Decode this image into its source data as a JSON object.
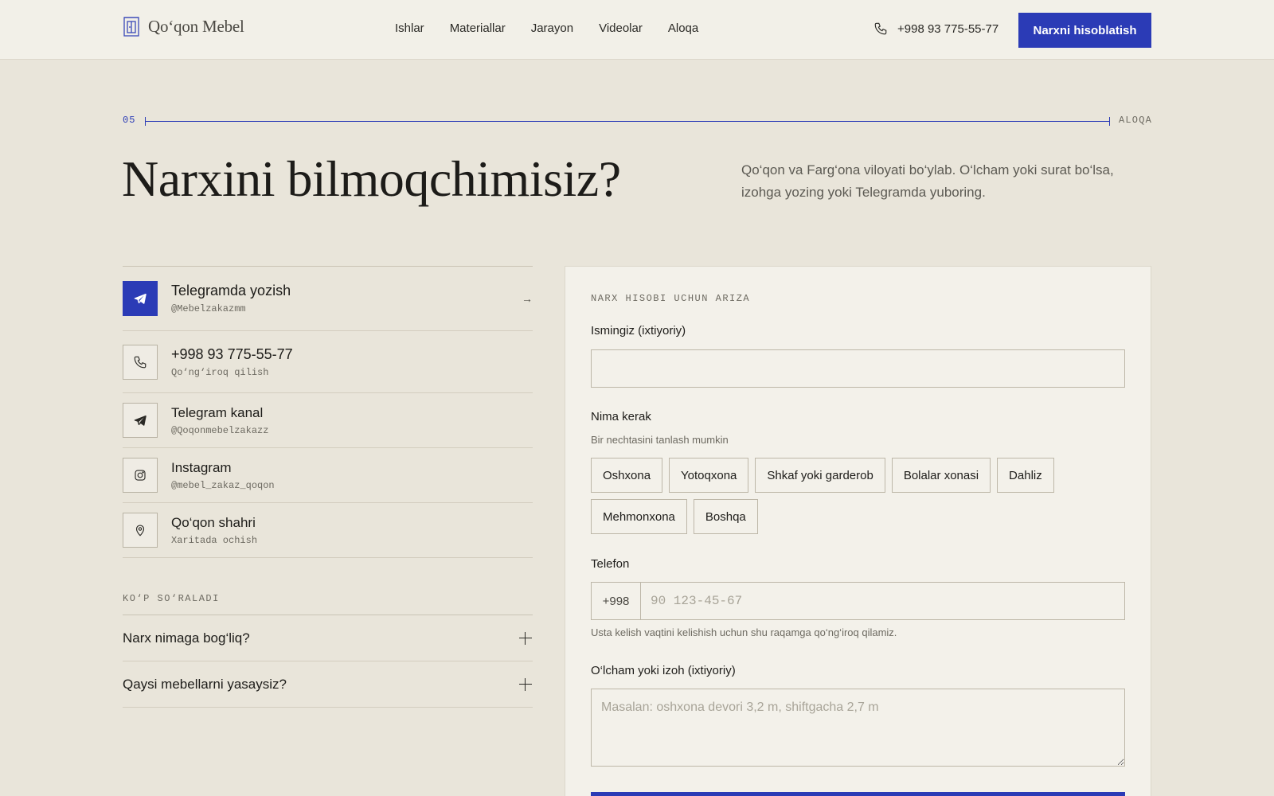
{
  "header": {
    "brand": "Qo‘qon Mebel",
    "nav": [
      "Ishlar",
      "Materiallar",
      "Jarayon",
      "Videolar",
      "Aloqa"
    ],
    "phone": "+998 93 775-55-77",
    "cta": "Narxni hisoblatish"
  },
  "section": {
    "number": "05",
    "label": "ALOQA",
    "title": "Narxini bilmoqchimisiz?",
    "description": "Qo‘qon va Farg‘ona viloyati bo‘ylab. O‘lcham yoki surat bo‘lsa, izohga yozing yoki Telegramda yuboring."
  },
  "contacts": [
    {
      "title": "Telegramda yozish",
      "sub": "@Mebelzakazmm",
      "icon": "telegram-icon"
    },
    {
      "title": "+998 93 775-55-77",
      "sub": "Qo‘ng‘iroq qilish",
      "icon": "phone-icon"
    },
    {
      "title": "Telegram kanal",
      "sub": "@Qoqonmebelzakazz",
      "icon": "telegram-icon"
    },
    {
      "title": "Instagram",
      "sub": "@mebel_zakaz_qoqon",
      "icon": "instagram-icon"
    },
    {
      "title": "Qo‘qon shahri",
      "sub": "Xaritada ochish",
      "icon": "location-pin-icon"
    }
  ],
  "faq": {
    "label": "KO‘P SO‘RALADI",
    "items": [
      "Narx nimaga bog‘liq?",
      "Qaysi mebellarni yasaysiz?"
    ]
  },
  "form": {
    "kicker": "NARX HISOBI UCHUN ARIZA",
    "name_label": "Ismingiz (ixtiyoriy)",
    "name_value": "",
    "need_label": "Nima kerak",
    "need_hint": "Bir nechtasini tanlash mumkin",
    "options": [
      "Oshxona",
      "Yotoqxona",
      "Shkaf yoki garderob",
      "Bolalar xonasi",
      "Dahliz",
      "Mehmonxona",
      "Boshqa"
    ],
    "phone_label": "Telefon",
    "phone_prefix": "+998",
    "phone_placeholder": "90 123-45-67",
    "phone_hint": "Usta kelish vaqtini kelishish uchun shu raqamga qo‘ng‘iroq qilamiz.",
    "note_label": "O‘lcham yoki izoh (ixtiyoriy)",
    "note_placeholder": "Masalan: oshxona devori 3,2 m, shiftgacha 2,7 m"
  },
  "colors": {
    "accent": "#2b3bb6",
    "background": "#e9e5da",
    "card": "#f3f1ea"
  }
}
